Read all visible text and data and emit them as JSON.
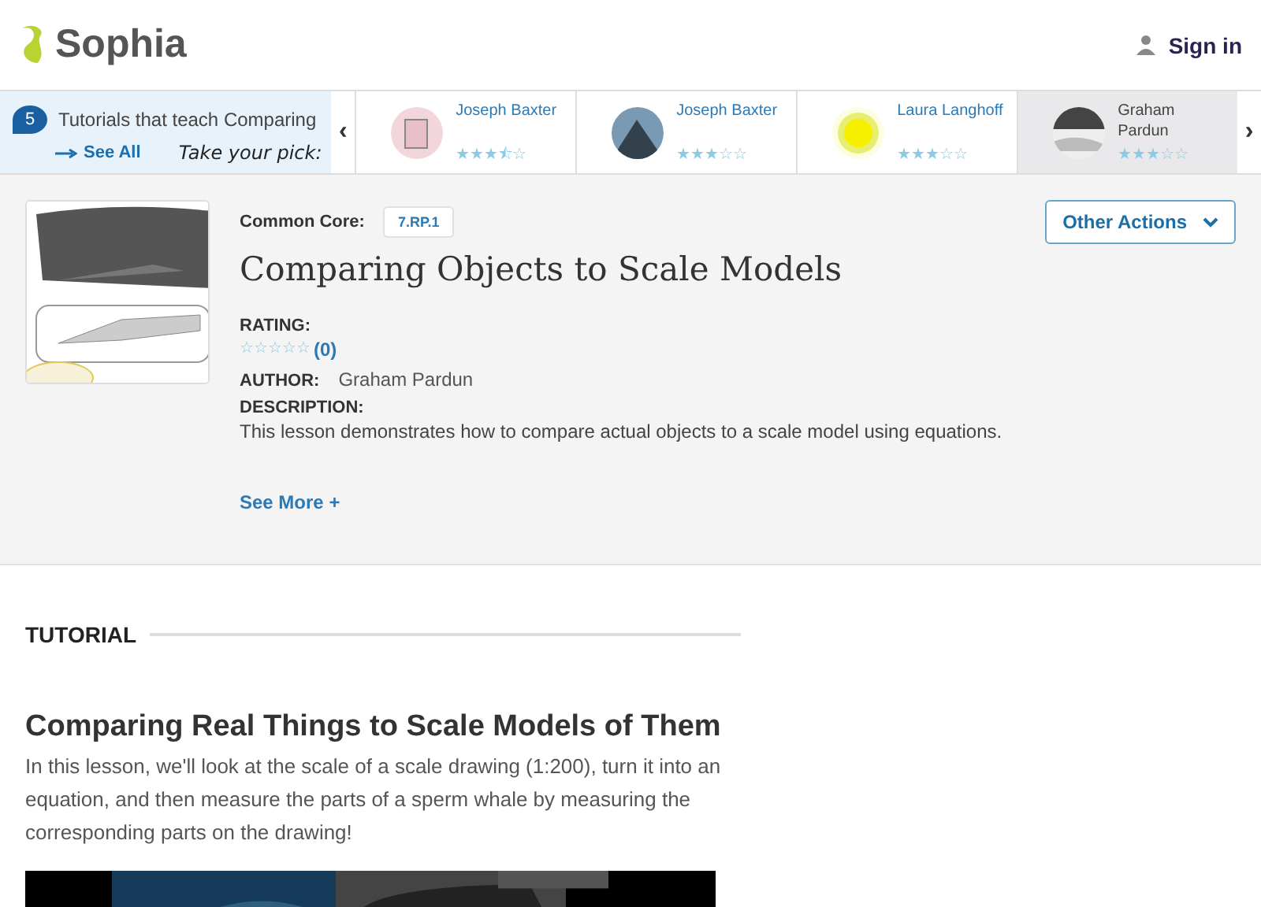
{
  "header": {
    "logo": "Sophia",
    "sign_in": "Sign in"
  },
  "carousel": {
    "count": "5",
    "title": "Tutorials that teach Comparing",
    "see_all": "See All",
    "pick": "Take your pick:",
    "prev": "‹",
    "next": "›",
    "items": [
      {
        "name": "Joseph Baxter",
        "stars": 3.5,
        "selected": false
      },
      {
        "name": "Joseph Baxter",
        "stars": 3,
        "selected": false
      },
      {
        "name": "Laura Langhoff",
        "stars": 3,
        "selected": false
      },
      {
        "name": "Graham Pardun",
        "stars": 3,
        "selected": true
      }
    ]
  },
  "lesson": {
    "common_core_label": "Common Core:",
    "standard": "7.RP.1",
    "title": "Comparing Objects to Scale Models",
    "other_actions": "Other Actions",
    "rating_label": "RATING:",
    "stars": 0,
    "rating_count": "(0)",
    "author_label": "AUTHOR:",
    "author": "Graham Pardun",
    "description_label": "DESCRIPTION:",
    "description": "This lesson demonstrates how to compare actual objects to a scale model using equations.",
    "see_more": "See More +"
  },
  "tutorial": {
    "section": "TUTORIAL",
    "heading": "Comparing Real Things to Scale Models of Them",
    "body": "In this lesson, we'll look at the scale of a scale drawing (1:200), turn it into an equation, and then measure the parts of a sperm whale by measuring the corresponding parts on the drawing!"
  }
}
